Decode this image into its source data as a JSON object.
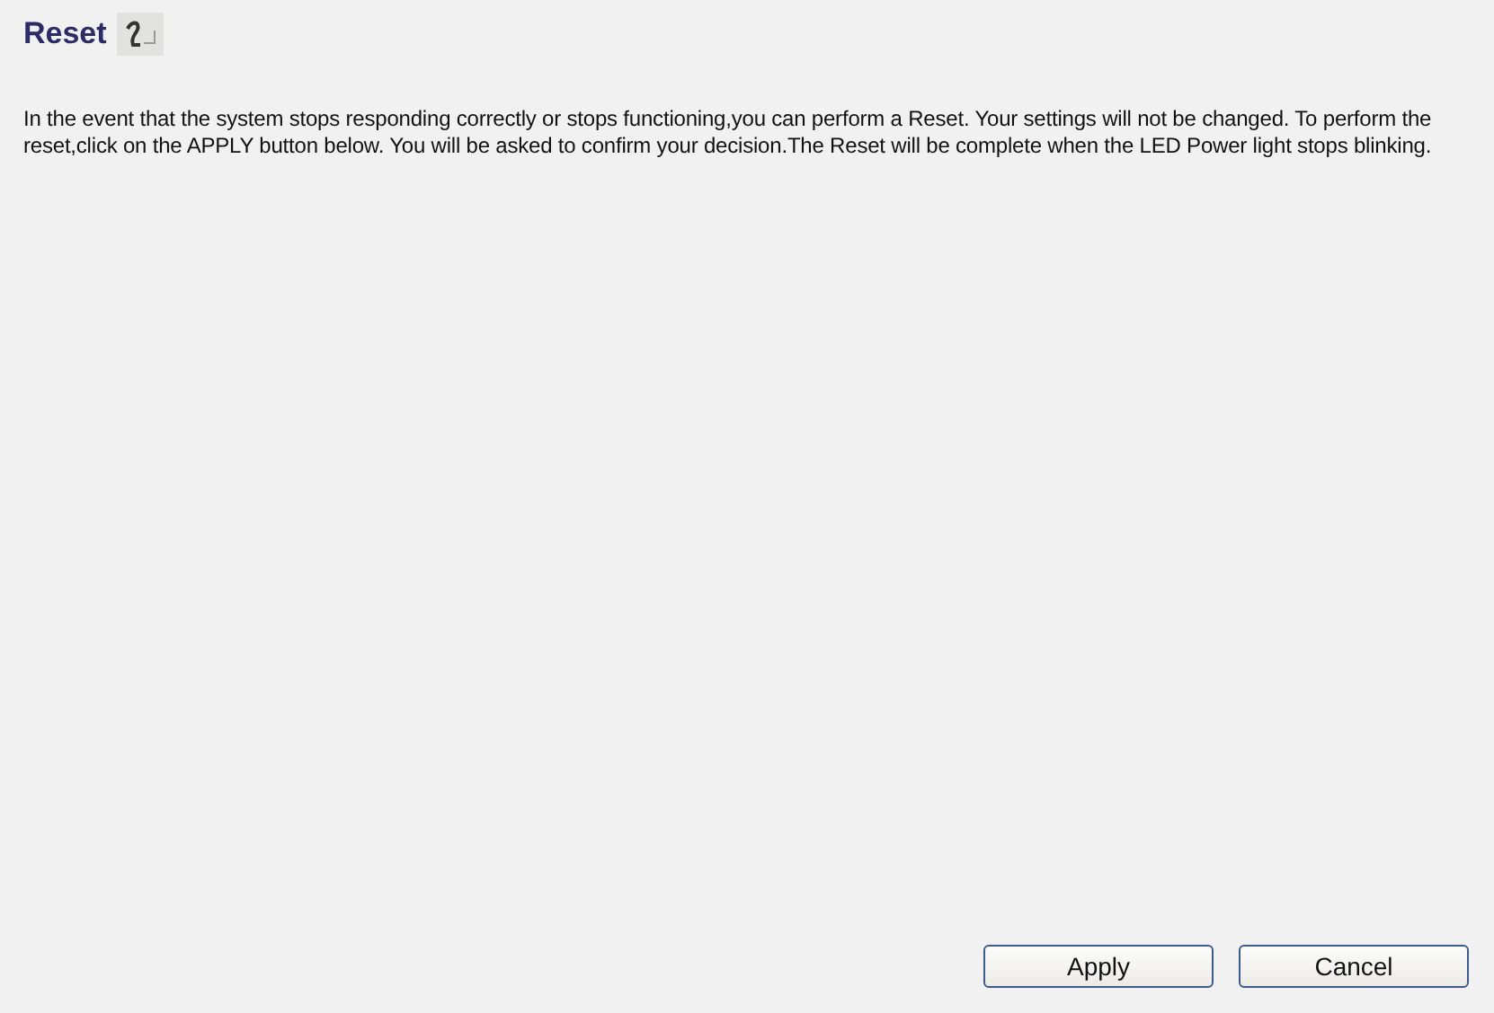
{
  "title": "Reset",
  "description": "In the event that the system stops responding correctly or stops functioning,you can perform a Reset. Your settings will not be changed. To perform the reset,click on the APPLY button below. You will be asked to confirm your decision.The Reset will be complete when the LED Power light stops blinking.",
  "buttons": [
    "Apply",
    "Cancel"
  ]
}
